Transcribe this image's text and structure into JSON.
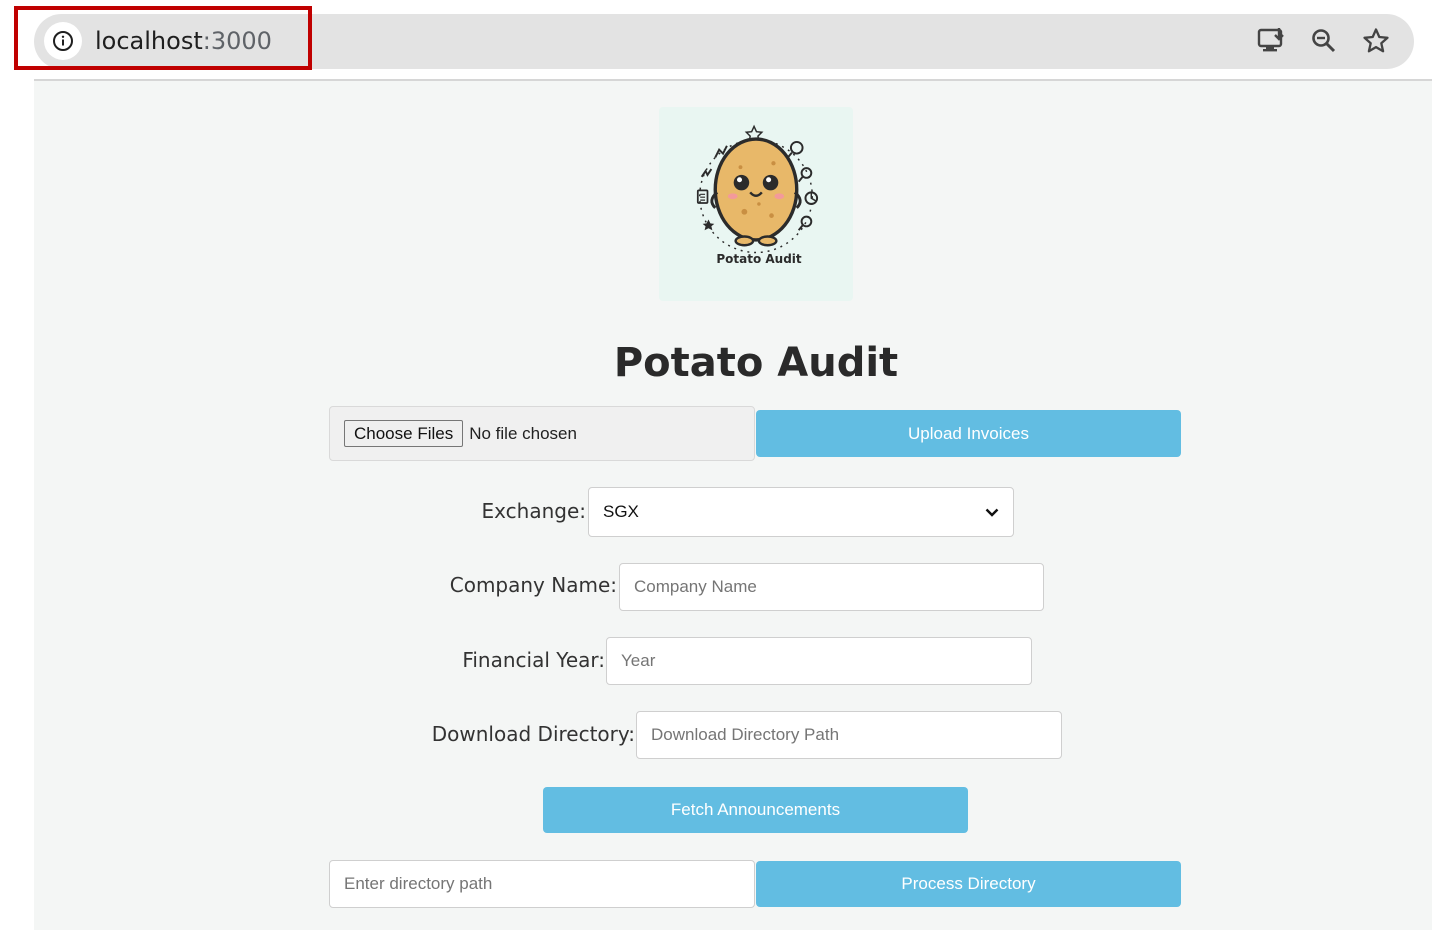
{
  "browser": {
    "url_host": "localhost",
    "url_port": ":3000"
  },
  "app": {
    "logo_caption": "Potato Audit",
    "title": "Potato Audit"
  },
  "upload": {
    "choose_label": "Choose Files",
    "file_status": "No file chosen",
    "upload_label": "Upload Invoices"
  },
  "form": {
    "exchange_label": "Exchange:",
    "exchange_value": "SGX",
    "company_label": "Company Name:",
    "company_placeholder": "Company Name",
    "year_label": "Financial Year:",
    "year_placeholder": "Year",
    "dir_label": "Download Directory:",
    "dir_placeholder": "Download Directory Path",
    "fetch_label": "Fetch Announcements"
  },
  "process": {
    "dir_placeholder": "Enter directory path",
    "process_label": "Process Directory"
  },
  "colors": {
    "accent": "#62bde2",
    "highlight": "#c00000"
  }
}
